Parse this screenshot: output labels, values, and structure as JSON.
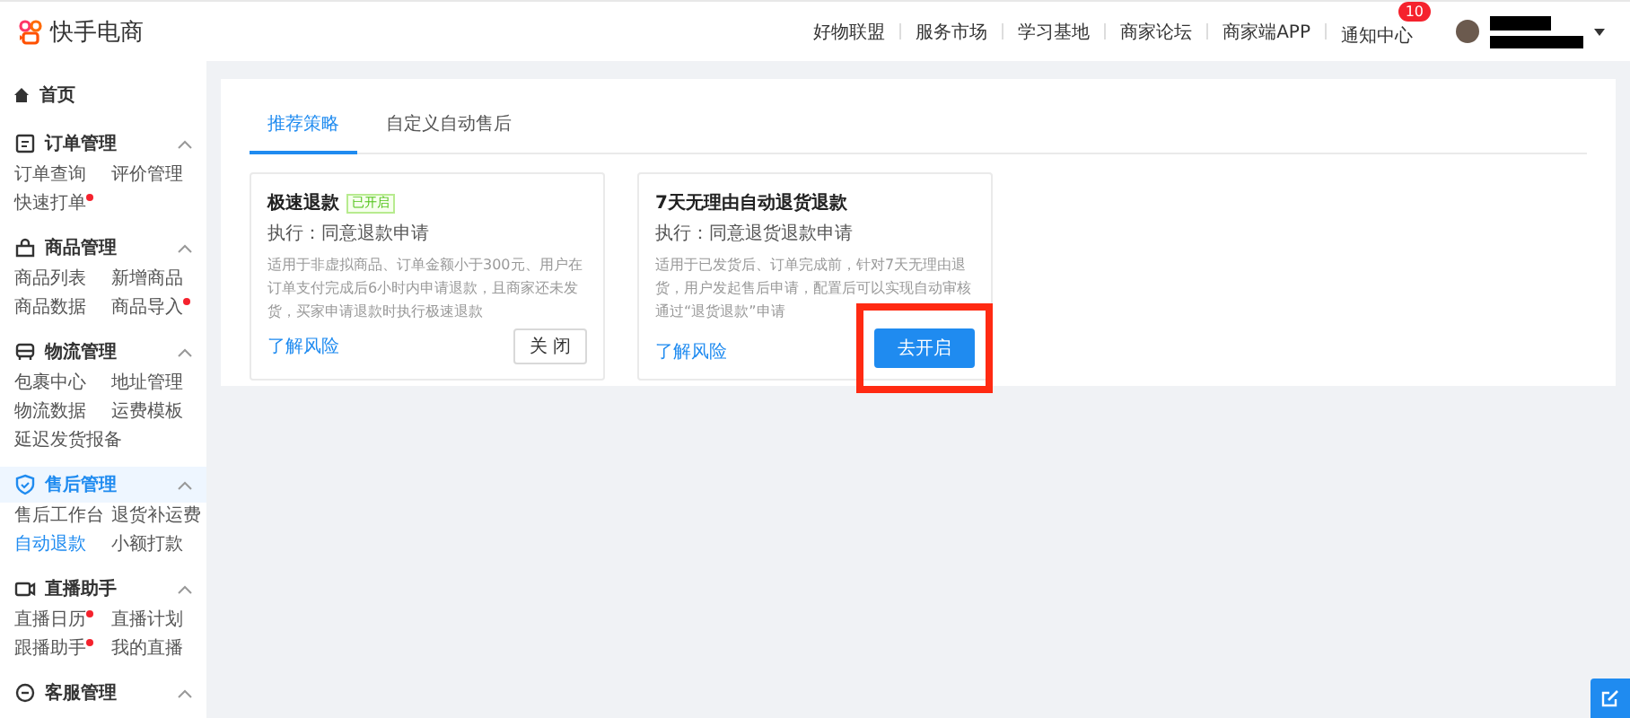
{
  "header": {
    "logo_text": "快手电商",
    "links": [
      "好物联盟",
      "服务市场",
      "学习基地",
      "商家论坛",
      "商家端APP",
      "通知中心"
    ],
    "notification_count": "10"
  },
  "sidebar": {
    "home": "首页",
    "groups": [
      {
        "title": "订单管理",
        "active": false,
        "expanded": true,
        "items": [
          {
            "label": "订单查询",
            "selected": false,
            "dot": false
          },
          {
            "label": "评价管理",
            "selected": false,
            "dot": false
          },
          {
            "label": "快速打单",
            "selected": false,
            "dot": true
          }
        ]
      },
      {
        "title": "商品管理",
        "active": false,
        "expanded": true,
        "items": [
          {
            "label": "商品列表",
            "selected": false,
            "dot": false
          },
          {
            "label": "新增商品",
            "selected": false,
            "dot": false
          },
          {
            "label": "商品数据",
            "selected": false,
            "dot": false
          },
          {
            "label": "商品导入",
            "selected": false,
            "dot": true
          }
        ]
      },
      {
        "title": "物流管理",
        "active": false,
        "expanded": true,
        "items": [
          {
            "label": "包裹中心",
            "selected": false,
            "dot": false
          },
          {
            "label": "地址管理",
            "selected": false,
            "dot": false
          },
          {
            "label": "物流数据",
            "selected": false,
            "dot": false
          },
          {
            "label": "运费模板",
            "selected": false,
            "dot": false
          },
          {
            "label": "延迟发货报备",
            "selected": false,
            "dot": false
          }
        ]
      },
      {
        "title": "售后管理",
        "active": true,
        "expanded": true,
        "items": [
          {
            "label": "售后工作台",
            "selected": false,
            "dot": false
          },
          {
            "label": "退货补运费",
            "selected": false,
            "dot": false
          },
          {
            "label": "自动退款",
            "selected": true,
            "dot": false
          },
          {
            "label": "小额打款",
            "selected": false,
            "dot": false
          }
        ]
      },
      {
        "title": "直播助手",
        "active": false,
        "expanded": true,
        "items": [
          {
            "label": "直播日历",
            "selected": false,
            "dot": true
          },
          {
            "label": "直播计划",
            "selected": false,
            "dot": false
          },
          {
            "label": "跟播助手",
            "selected": false,
            "dot": true
          },
          {
            "label": "我的直播",
            "selected": false,
            "dot": false
          }
        ]
      },
      {
        "title": "客服管理",
        "active": false,
        "expanded": true
      }
    ]
  },
  "tabs": [
    {
      "label": "推荐策略",
      "selected": true
    },
    {
      "label": "自定义自动售后",
      "selected": false
    }
  ],
  "cards": [
    {
      "title": "极速退款",
      "badge": "已开启",
      "subtitle": "执行：同意退款申请",
      "description": "适用于非虚拟商品、订单金额小于300元、用户在订单支付完成后6小时内申请退款，且商家还未发货，买家申请退款时执行极速退款",
      "link": "了解风险",
      "button": {
        "label": "关 闭",
        "kind": "default"
      },
      "highlighted": false
    },
    {
      "title": "7天无理由自动退货退款",
      "subtitle": "执行：同意退货退款申请",
      "description": "适用于已发货后、订单完成前，针对7天无理由退货，用户发起售后申请，配置后可以实现自动审核通过“退货退款”申请",
      "link": "了解风险",
      "button": {
        "label": "去开启",
        "kind": "primary"
      },
      "highlighted": true
    }
  ]
}
